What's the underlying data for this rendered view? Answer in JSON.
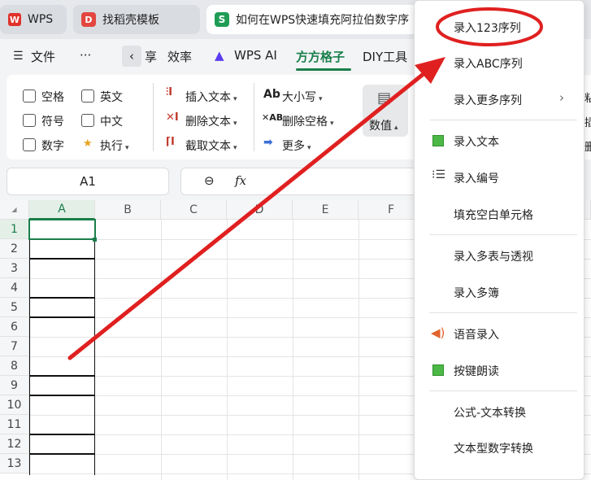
{
  "tabs": [
    {
      "label": "WPS",
      "logo": "W"
    },
    {
      "label": "找稻壳模板",
      "logo": "D"
    },
    {
      "label": "如何在WPS快速填充阿拉伯数字序",
      "logo": "S"
    }
  ],
  "menubar": {
    "file_label": "文件",
    "more_label": "···",
    "share_label": "享",
    "efficiency_label": "效率",
    "wpsai_label": "WPS AI",
    "fangfang_label": "方方格子",
    "diy_label": "DIY工具"
  },
  "ribbon": {
    "checkboxes": [
      "空格",
      "英文",
      "符号",
      "中文",
      "数字"
    ],
    "execute_label": "执行",
    "insert_text": "插入文本",
    "delete_text": "删除文本",
    "extract_text": "截取文本",
    "case_label": "大小写",
    "delete_space": "删除空格",
    "more_label": "更多",
    "numval_label": "数值",
    "right_partial": [
      "粘",
      "插",
      "删"
    ]
  },
  "formula_bar": {
    "cell_ref": "A1",
    "fx_label": "fx"
  },
  "sheet": {
    "columns": [
      "A",
      "B",
      "C",
      "D",
      "E",
      "F"
    ],
    "rows": [
      "1",
      "2",
      "3",
      "4",
      "5",
      "6",
      "7",
      "8",
      "9",
      "10",
      "11",
      "12",
      "13"
    ]
  },
  "dropdown": {
    "items": [
      "录入123序列",
      "录入ABC序列",
      "录入更多序列",
      "录入文本",
      "录入编号",
      "填充空白单元格",
      "录入多表与透视",
      "录入多簿",
      "语音录入",
      "按键朗读",
      "公式-文本转换",
      "文本型数字转换"
    ]
  },
  "annotation": {
    "arrow_color": "#e02020",
    "circle_color": "#e02020"
  }
}
